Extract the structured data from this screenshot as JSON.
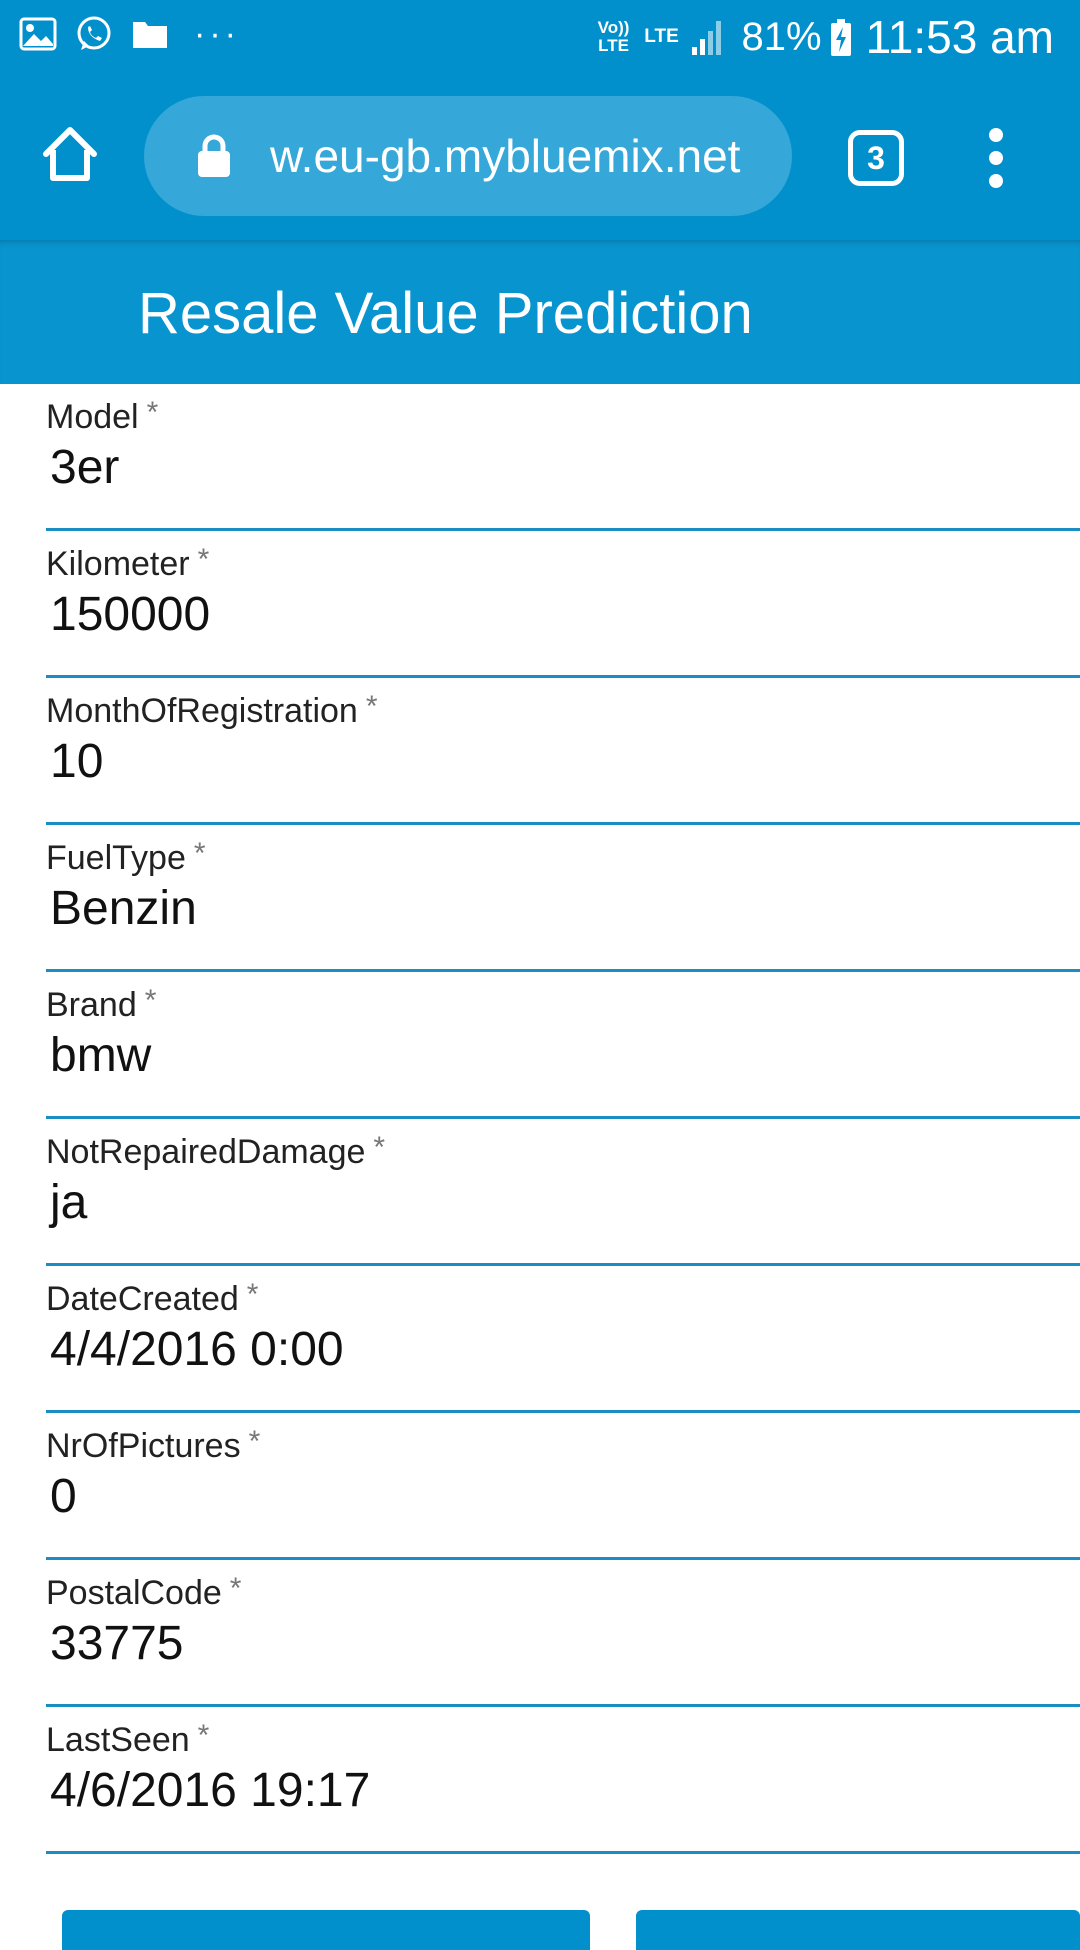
{
  "status_bar": {
    "left_icons": [
      "image-icon",
      "whatsapp-icon",
      "folder-icon"
    ],
    "more": "···",
    "volte": "Vo)) LTE",
    "lte": "LTE",
    "battery_percent": "81%",
    "time": "11:53 am"
  },
  "browser": {
    "url": "w.eu-gb.mybluemix.net",
    "tab_count": "3"
  },
  "app": {
    "title": "Resale Value Prediction"
  },
  "form": {
    "required_marker": "*",
    "fields": [
      {
        "label": "Model",
        "value": "3er"
      },
      {
        "label": "Kilometer",
        "value": "150000"
      },
      {
        "label": "MonthOfRegistration",
        "value": "10"
      },
      {
        "label": "FuelType",
        "value": "Benzin"
      },
      {
        "label": "Brand",
        "value": "bmw"
      },
      {
        "label": "NotRepairedDamage",
        "value": "ja"
      },
      {
        "label": "DateCreated",
        "value": "4/4/2016 0:00"
      },
      {
        "label": "NrOfPictures",
        "value": "0"
      },
      {
        "label": "PostalCode",
        "value": "33775"
      },
      {
        "label": "LastSeen",
        "value": "4/6/2016 19:17"
      }
    ]
  },
  "colors": {
    "bar": "#0290cc",
    "header": "#0894cf",
    "underline": "#1a8dc2"
  }
}
